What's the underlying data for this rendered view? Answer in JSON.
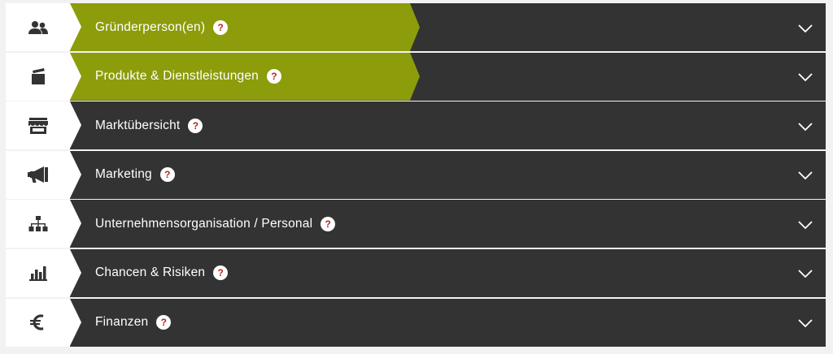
{
  "colors": {
    "accent_green": "#8c9c0b",
    "row_dark": "#333333",
    "help_mark": "#b3272a"
  },
  "sections": [
    {
      "label": "Gründerperson(en)",
      "icon": "users-icon",
      "help": "?",
      "completed": true
    },
    {
      "label": "Produkte & Dienstleistungen",
      "icon": "clapperboard-icon",
      "help": "?",
      "completed": true
    },
    {
      "label": "Marktübersicht",
      "icon": "storefront-icon",
      "help": "?",
      "completed": false
    },
    {
      "label": "Marketing",
      "icon": "megaphone-icon",
      "help": "?",
      "completed": false
    },
    {
      "label": "Unternehmensorganisation / Personal",
      "icon": "org-chart-icon",
      "help": "?",
      "completed": false
    },
    {
      "label": "Chancen & Risiken",
      "icon": "bar-chart-icon",
      "help": "?",
      "completed": false
    },
    {
      "label": "Finanzen",
      "icon": "euro-icon",
      "help": "?",
      "completed": false
    }
  ]
}
